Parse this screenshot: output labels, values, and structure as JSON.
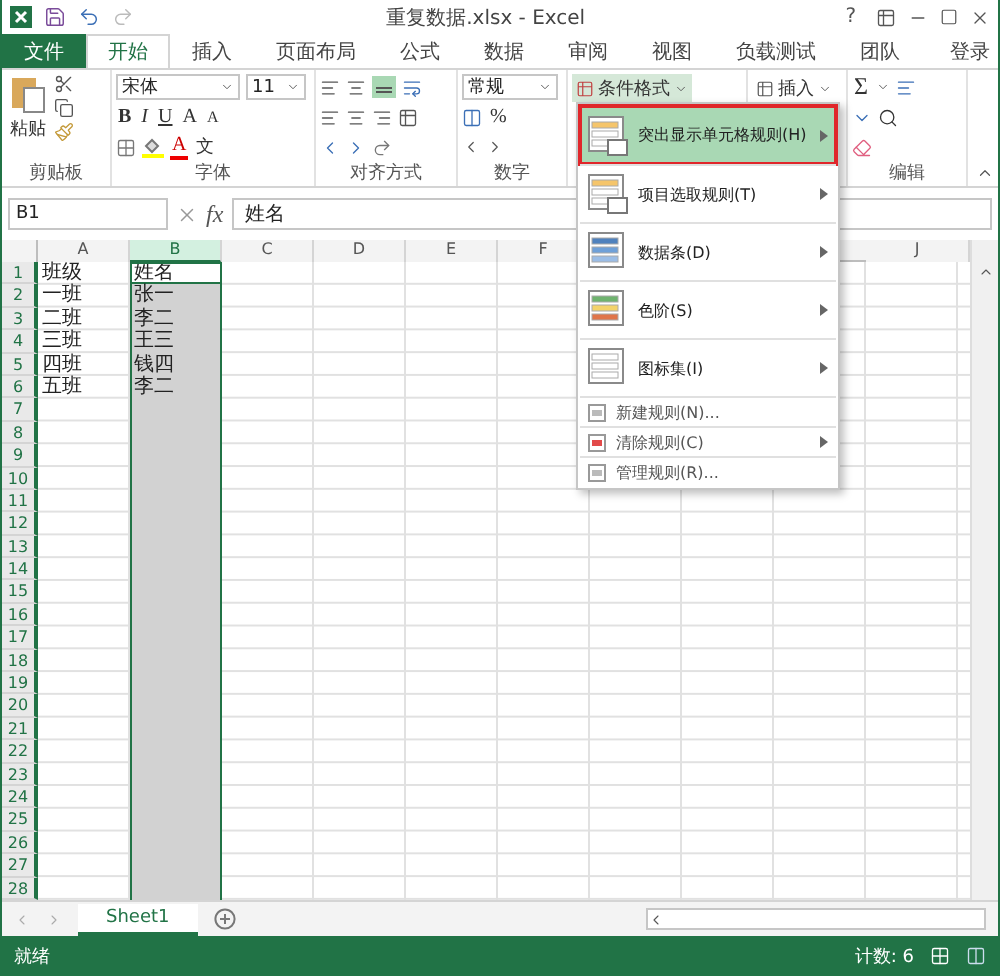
{
  "window": {
    "title": "重复数据.xlsx - Excel",
    "help": "?"
  },
  "ribbon_tabs": [
    {
      "label": "文件",
      "kind": "file",
      "selected": false
    },
    {
      "label": "开始",
      "kind": "tab",
      "selected": true
    },
    {
      "label": "插入",
      "kind": "tab",
      "selected": false
    },
    {
      "label": "页面布局",
      "kind": "tab",
      "selected": false
    },
    {
      "label": "公式",
      "kind": "tab",
      "selected": false
    },
    {
      "label": "数据",
      "kind": "tab",
      "selected": false
    },
    {
      "label": "审阅",
      "kind": "tab",
      "selected": false
    },
    {
      "label": "视图",
      "kind": "tab",
      "selected": false
    },
    {
      "label": "负载测试",
      "kind": "tab",
      "selected": false
    },
    {
      "label": "团队",
      "kind": "tab",
      "selected": false
    }
  ],
  "account": "登录",
  "clipboard_group": {
    "paste": "粘贴",
    "label": "剪贴板"
  },
  "font_group": {
    "font_name": "宋体",
    "font_size": "11",
    "bold": "B",
    "italic": "I",
    "underline": "U",
    "grow": "A",
    "shrink": "A",
    "font_color": "A",
    "phonetic": "文",
    "label": "字体"
  },
  "alignment_group": {
    "label": "对齐方式"
  },
  "number_group": {
    "format": "常规",
    "percent": "%",
    "label": "数字"
  },
  "styles_group": {
    "conditional_format": "条件格式"
  },
  "cells_group": {
    "insert": "插入"
  },
  "editing_group": {
    "autosum": "Σ",
    "label": "编辑"
  },
  "name_box": "B1",
  "formula_bar": {
    "fx": "fx",
    "value": "姓名"
  },
  "columns": [
    {
      "label": "A",
      "selected": false
    },
    {
      "label": "B",
      "selected": true
    },
    {
      "label": "C",
      "selected": false
    },
    {
      "label": "D",
      "selected": false
    },
    {
      "label": "E",
      "selected": false
    },
    {
      "label": "F",
      "selected": false
    }
  ],
  "far_columns": [
    {
      "label": "J",
      "selected": false
    }
  ],
  "rows": [
    {
      "number": "1",
      "cells": [
        {
          "text": "班级",
          "active": false
        },
        {
          "text": "姓名",
          "active": true
        }
      ]
    },
    {
      "number": "2",
      "cells": [
        {
          "text": "一班",
          "active": false
        },
        {
          "text": "张一",
          "active": false
        }
      ]
    },
    {
      "number": "3",
      "cells": [
        {
          "text": "二班",
          "active": false
        },
        {
          "text": "李二",
          "active": false
        }
      ]
    },
    {
      "number": "4",
      "cells": [
        {
          "text": "三班",
          "active": false
        },
        {
          "text": "王三",
          "active": false
        }
      ]
    },
    {
      "number": "5",
      "cells": [
        {
          "text": "四班",
          "active": false
        },
        {
          "text": "钱四",
          "active": false
        }
      ]
    },
    {
      "number": "6",
      "cells": [
        {
          "text": "五班",
          "active": false
        },
        {
          "text": "李二",
          "active": false
        }
      ]
    },
    {
      "number": "7"
    },
    {
      "number": "8"
    },
    {
      "number": "9"
    },
    {
      "number": "10"
    },
    {
      "number": "11"
    },
    {
      "number": "12"
    },
    {
      "number": "13"
    },
    {
      "number": "14"
    },
    {
      "number": "15"
    },
    {
      "number": "16"
    },
    {
      "number": "17"
    },
    {
      "number": "18"
    },
    {
      "number": "19"
    },
    {
      "number": "20"
    },
    {
      "number": "21"
    },
    {
      "number": "22"
    },
    {
      "number": "23"
    },
    {
      "number": "24"
    },
    {
      "number": "25"
    },
    {
      "number": "26"
    },
    {
      "number": "27"
    },
    {
      "number": "28"
    }
  ],
  "menu": {
    "items": [
      {
        "label": "突出显示单元格规则(H)",
        "kind": "large",
        "selected": true,
        "submenu": true
      },
      {
        "label": "项目选取规则(T)",
        "kind": "large",
        "selected": false,
        "submenu": true
      },
      {
        "label": "数据条(D)",
        "kind": "large",
        "selected": false,
        "submenu": true
      },
      {
        "label": "色阶(S)",
        "kind": "large",
        "selected": false,
        "submenu": true
      },
      {
        "label": "图标集(I)",
        "kind": "large",
        "selected": false,
        "submenu": true
      },
      {
        "label": "新建规则(N)...",
        "kind": "small",
        "selected": false,
        "submenu": false
      },
      {
        "label": "清除规则(C)",
        "kind": "small",
        "selected": false,
        "submenu": true
      },
      {
        "label": "管理规则(R)...",
        "kind": "small",
        "selected": false,
        "submenu": false
      }
    ]
  },
  "sheet_tabs": [
    {
      "label": "Sheet1",
      "selected": true
    }
  ],
  "status_bar": {
    "status": "就绪",
    "count": "计数: 6"
  }
}
